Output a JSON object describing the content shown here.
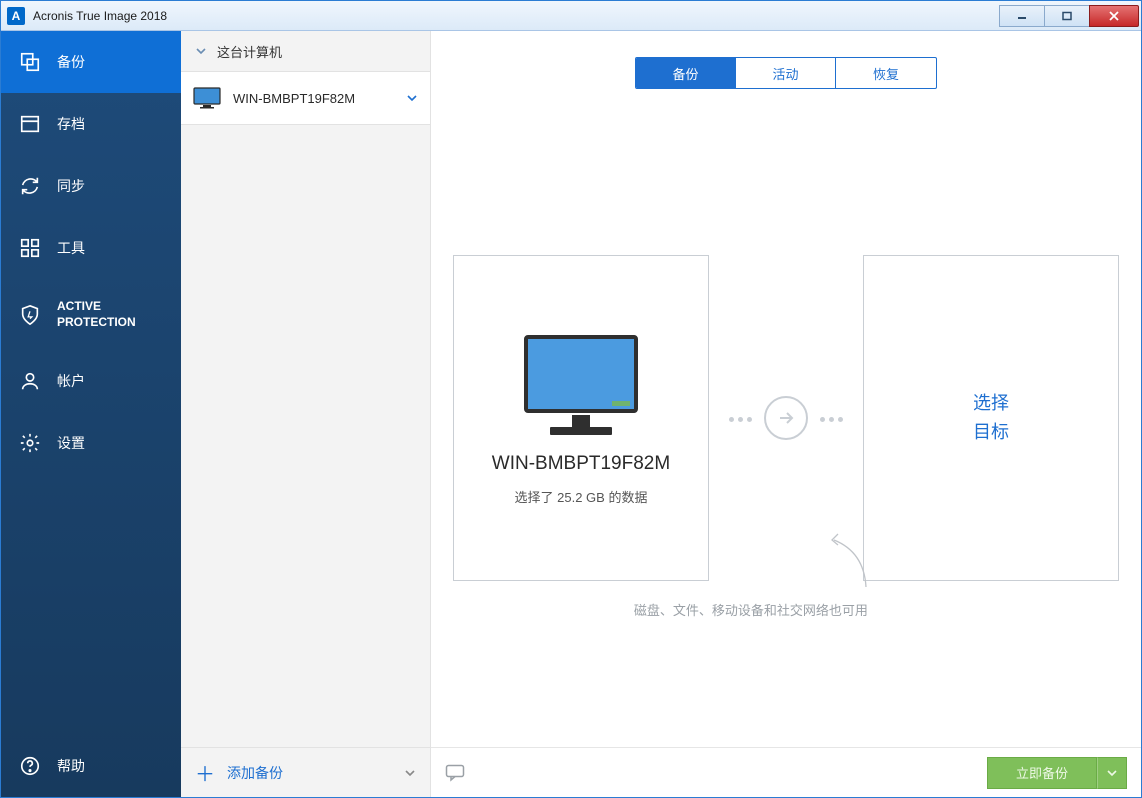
{
  "titlebar": {
    "title": "Acronis True Image 2018",
    "logo_letter": "A"
  },
  "nav": {
    "items": [
      {
        "id": "backup",
        "label": "备份"
      },
      {
        "id": "archive",
        "label": "存档"
      },
      {
        "id": "sync",
        "label": "同步"
      },
      {
        "id": "tools",
        "label": "工具"
      },
      {
        "id": "active_protection",
        "label": "ACTIVE\nPROTECTION"
      },
      {
        "id": "account",
        "label": "帐户"
      },
      {
        "id": "settings",
        "label": "设置"
      }
    ],
    "help_label": "帮助"
  },
  "listcol": {
    "header": "这台计算机",
    "items": [
      {
        "name": "WIN-BMBPT19F82M"
      }
    ],
    "add_label": "添加备份"
  },
  "tabs": {
    "items": [
      {
        "id": "backup",
        "label": "备份",
        "active": true
      },
      {
        "id": "activity",
        "label": "活动",
        "active": false
      },
      {
        "id": "recover",
        "label": "恢复",
        "active": false
      }
    ]
  },
  "source_card": {
    "title": "WIN-BMBPT19F82M",
    "subtitle": "选择了 25.2 GB 的数据"
  },
  "dest_card": {
    "line1": "选择",
    "line2": "目标"
  },
  "hint": "磁盘、文件、移动设备和社交网络也可用",
  "footer": {
    "start_label": "立即备份"
  }
}
